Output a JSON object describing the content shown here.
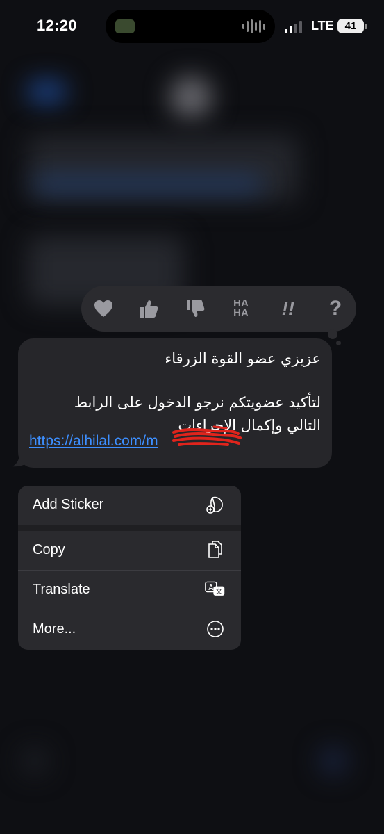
{
  "status_bar": {
    "time": "12:20",
    "network": "LTE",
    "battery": "41"
  },
  "tapback": {
    "reactions": [
      {
        "name": "heart-icon"
      },
      {
        "name": "thumbs-up-icon"
      },
      {
        "name": "thumbs-down-icon"
      },
      {
        "name": "haha-icon",
        "line1": "HA",
        "line2": "HA"
      },
      {
        "name": "exclamation-icon",
        "label": "!!"
      },
      {
        "name": "question-icon",
        "label": "?"
      }
    ]
  },
  "message": {
    "line1": "عزيزي عضو القوة الزرقاء",
    "line2": "لتأكيد عضويتكم نرجو الدخول على الرابط",
    "line3": "التالي وإكمال الإجراءات",
    "link": "https://alhilal.com/m"
  },
  "menu": {
    "add_sticker": "Add Sticker",
    "copy": "Copy",
    "translate": "Translate",
    "more": "More..."
  },
  "colors": {
    "link": "#3d8fff",
    "bubble": "#26262a",
    "menu": "#2a2a2e",
    "scribble": "#e0241c"
  }
}
